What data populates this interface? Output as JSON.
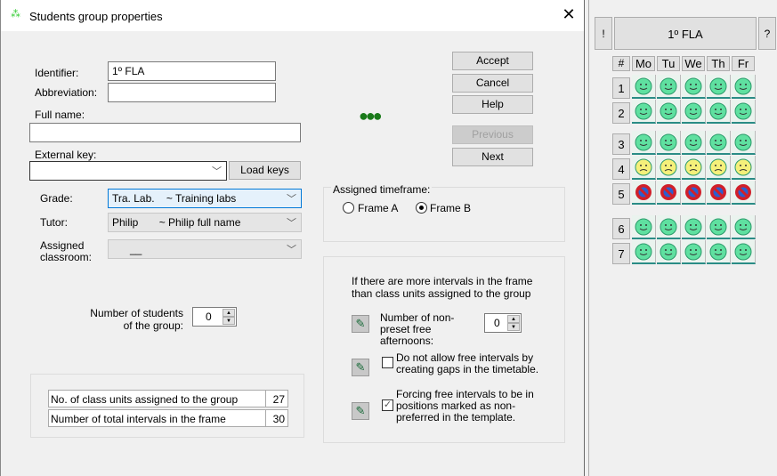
{
  "window": {
    "title": "Students group properties",
    "close": "✕",
    "icon": "group-icon"
  },
  "form": {
    "identifier_label": "Identifier:",
    "identifier_value": "1º FLA",
    "abbreviation_label": "Abbreviation:",
    "abbreviation_value": "",
    "fullname_label": "Full name:",
    "fullname_value": "",
    "extkey_label": "External key:",
    "extkey_value": "",
    "load_keys": "Load keys",
    "grade_label": "Grade:",
    "grade_value": "Tra. Lab.    ~ Training labs",
    "tutor_label": "Tutor:",
    "tutor_value": "Philip       ~ Philip full name",
    "classroom_label": "Assigned classroom:",
    "classroom_value": "      __",
    "students_label": "Number of students of the group:",
    "students_value": "0"
  },
  "buttons": {
    "accept": "Accept",
    "cancel": "Cancel",
    "help": "Help",
    "previous": "Previous",
    "next": "Next"
  },
  "timeframe": {
    "label": "Assigned timeframe:",
    "options": [
      "Frame A",
      "Frame B"
    ],
    "selected": "Frame B"
  },
  "intervals": {
    "intro": "If there are more intervals in the frame than class units assigned to the group",
    "afternoons_label": "Number of non-preset free afternoons:",
    "afternoons_value": "0",
    "no_gaps_label": "Do not allow free intervals by creating gaps in the timetable.",
    "no_gaps_checked": false,
    "force_label": "Forcing free intervals to be in positions marked as non-preferred in the template.",
    "force_checked": true
  },
  "stats": [
    {
      "label": "No. of class units assigned to the group",
      "value": "27"
    },
    {
      "label": "Number of total intervals in the frame",
      "value": "30"
    }
  ],
  "grid": {
    "excl": "!",
    "title": "1º FLA",
    "help": "?",
    "hash": "#",
    "days": [
      "Mo",
      "Tu",
      "We",
      "Th",
      "Fr"
    ],
    "rows": [
      {
        "n": "1",
        "state": "preferred"
      },
      {
        "n": "2",
        "state": "preferred"
      },
      {
        "n": "3",
        "state": "preferred"
      },
      {
        "n": "4",
        "state": "non-preferred"
      },
      {
        "n": "5",
        "state": "forbidden"
      },
      {
        "n": "6",
        "state": "preferred"
      },
      {
        "n": "7",
        "state": "preferred"
      }
    ],
    "colors": {
      "preferred": "#5fe0a0",
      "non-preferred": "#f5f07a",
      "forbidden": "#d0202a"
    }
  }
}
